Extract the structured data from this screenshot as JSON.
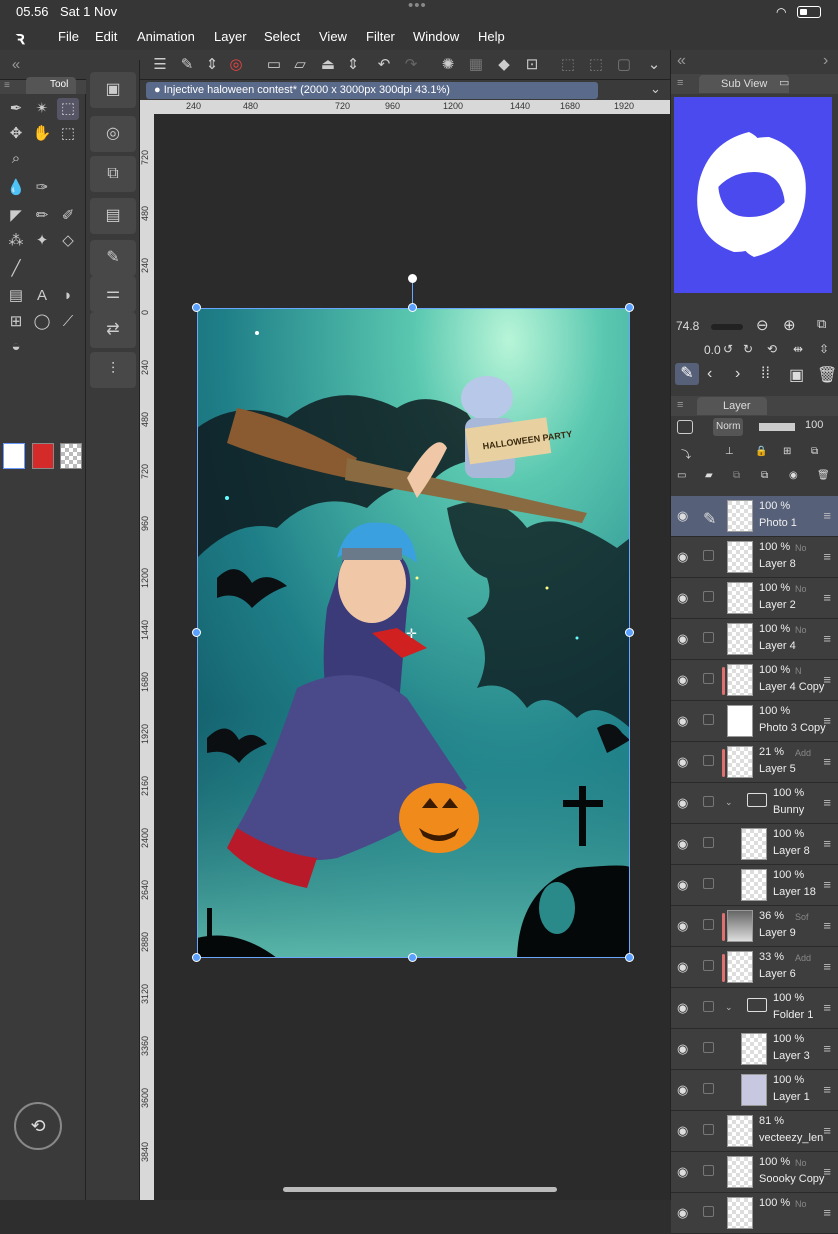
{
  "status": {
    "time": "05.56",
    "date": "Sat 1 Nov"
  },
  "menu": [
    "File",
    "Edit",
    "Animation",
    "Layer",
    "Select",
    "View",
    "Filter",
    "Window",
    "Help"
  ],
  "tool_palette": {
    "tab_label": "Tool"
  },
  "document": {
    "tab_title": "Injective haloween contest* (2000 x 3000px 300dpi 43.1%)"
  },
  "ruler": {
    "h": [
      "240",
      "480",
      "720",
      "960",
      "1200",
      "1440",
      "1680",
      "1920"
    ],
    "v": [
      "720",
      "480",
      "240",
      "0",
      "240",
      "480",
      "720",
      "960",
      "1200",
      "1440",
      "1680",
      "1920",
      "2160",
      "2400",
      "2640",
      "2880",
      "3120",
      "3360",
      "3600",
      "3840"
    ]
  },
  "artwork": {
    "banner": "HALLOWEEN PARTY"
  },
  "subview": {
    "label": "Sub View"
  },
  "navigator": {
    "zoom": "74.8",
    "rotation": "0.0"
  },
  "layer_panel": {
    "label": "Layer",
    "blend_mode": "Norm",
    "opacity": "100"
  },
  "layers": [
    {
      "opacity": "100 %",
      "mode": "",
      "name": "Photo 1",
      "selected": true,
      "marked": false,
      "type": "photo"
    },
    {
      "opacity": "100 %",
      "mode": "No",
      "name": "Layer 8",
      "selected": false,
      "marked": false,
      "type": "raster"
    },
    {
      "opacity": "100 %",
      "mode": "No",
      "name": "Layer 2",
      "selected": false,
      "marked": false,
      "type": "raster"
    },
    {
      "opacity": "100 %",
      "mode": "No",
      "name": "Layer 4",
      "selected": false,
      "marked": false,
      "type": "raster"
    },
    {
      "opacity": "100 %",
      "mode": "N",
      "name": "Layer 4 Copy",
      "selected": false,
      "marked": true,
      "type": "raster"
    },
    {
      "opacity": "100 %",
      "mode": "",
      "name": "Photo 3 Copy",
      "selected": false,
      "marked": false,
      "type": "photo-logo"
    },
    {
      "opacity": "21 %",
      "mode": "Add",
      "name": "Layer 5",
      "selected": false,
      "marked": true,
      "type": "raster"
    },
    {
      "opacity": "100 %",
      "mode": "",
      "name": "Bunny",
      "selected": false,
      "marked": false,
      "type": "folder"
    },
    {
      "opacity": "100 %",
      "mode": "",
      "name": "Layer 8",
      "selected": false,
      "marked": false,
      "type": "raster-indent"
    },
    {
      "opacity": "100 %",
      "mode": "",
      "name": "Layer 18",
      "selected": false,
      "marked": false,
      "type": "raster-indent"
    },
    {
      "opacity": "36 %",
      "mode": "Sof",
      "name": "Layer 9",
      "selected": false,
      "marked": true,
      "type": "raster-dark"
    },
    {
      "opacity": "33 %",
      "mode": "Add",
      "name": "Layer 6",
      "selected": false,
      "marked": true,
      "type": "raster"
    },
    {
      "opacity": "100 %",
      "mode": "",
      "name": "Folder 1",
      "selected": false,
      "marked": false,
      "type": "folder"
    },
    {
      "opacity": "100 %",
      "mode": "",
      "name": "Layer 3",
      "selected": false,
      "marked": false,
      "type": "raster-indent"
    },
    {
      "opacity": "100 %",
      "mode": "",
      "name": "Layer 1",
      "selected": false,
      "marked": false,
      "type": "raster-indent-art"
    },
    {
      "opacity": "81 %",
      "mode": "",
      "name": "vecteezy_len",
      "selected": false,
      "marked": false,
      "type": "photo"
    },
    {
      "opacity": "100 %",
      "mode": "No",
      "name": "Soooky Copy",
      "selected": false,
      "marked": false,
      "type": "raster"
    },
    {
      "opacity": "100 %",
      "mode": "No",
      "name": "",
      "selected": false,
      "marked": false,
      "type": "raster"
    }
  ],
  "colors": {
    "accent": "#4a4aee",
    "main_color": "#ffffff",
    "sub_color": "#d42a2a",
    "bg_sky": "#2a8e8e"
  }
}
